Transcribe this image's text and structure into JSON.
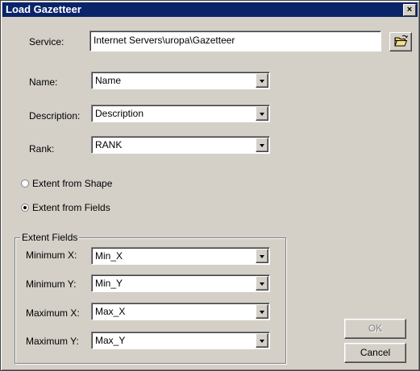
{
  "window": {
    "title": "Load Gazetteer",
    "close_label": "×"
  },
  "service": {
    "label": "Service:",
    "value": "Internet Servers\\uropa\\Gazetteer",
    "browse_icon": "open-folder-icon"
  },
  "fields": {
    "name": {
      "label": "Name:",
      "value": "Name"
    },
    "description": {
      "label": "Description:",
      "value": "Description"
    },
    "rank": {
      "label": "Rank:",
      "value": "RANK"
    }
  },
  "extent_options": {
    "from_shape": {
      "label": "Extent from Shape",
      "checked": false
    },
    "from_fields": {
      "label": "Extent from Fields",
      "checked": true
    }
  },
  "extent_fields": {
    "legend": "Extent Fields",
    "min_x": {
      "label": "Minimum X:",
      "value": "Min_X"
    },
    "min_y": {
      "label": "Minimum Y:",
      "value": "Min_Y"
    },
    "max_x": {
      "label": "Maximum X:",
      "value": "Max_X"
    },
    "max_y": {
      "label": "Maximum Y:",
      "value": "Max_Y"
    }
  },
  "buttons": {
    "ok": "OK",
    "cancel": "Cancel"
  }
}
